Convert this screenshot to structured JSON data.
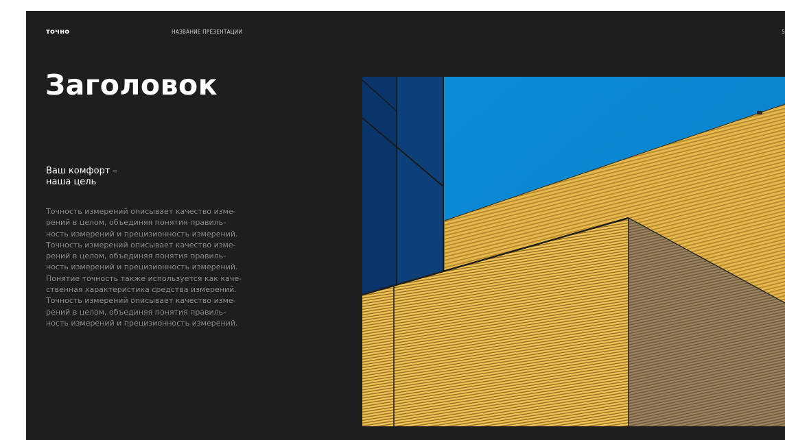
{
  "header": {
    "logo": "точно",
    "presentation_title": "НАЗВАНИЕ ПРЕЗЕНТАЦИИ",
    "page_number": "5"
  },
  "main": {
    "heading": "Заголовок",
    "subheading": "Ваш комфорт –\nнаша цель",
    "body_lines": [
      "Точность измерений описывает качество изме-",
      "рений в целом, объединяя понятия правиль-",
      "ность измерений и прецизионность измерений.",
      "Точность измерений описывает качество изме-",
      "рений в целом, объединяя понятия правиль-",
      "ность измерений и прецизионность измерений.",
      "Понятие точность также используется как каче-",
      "ственная характеристика средства измерений.",
      "Точность измерений описывает качество изме-",
      "рений в целом, объединяя понятия правиль-",
      "ность измерений и прецизионность измерений."
    ]
  },
  "photo": {
    "subject": "building-facade-photo",
    "colors": {
      "sky": "#0a8ed8",
      "facade_yellow": "#e0b04a",
      "facade_shadow": "#8f7a52",
      "glass": "#0d3f78"
    }
  }
}
